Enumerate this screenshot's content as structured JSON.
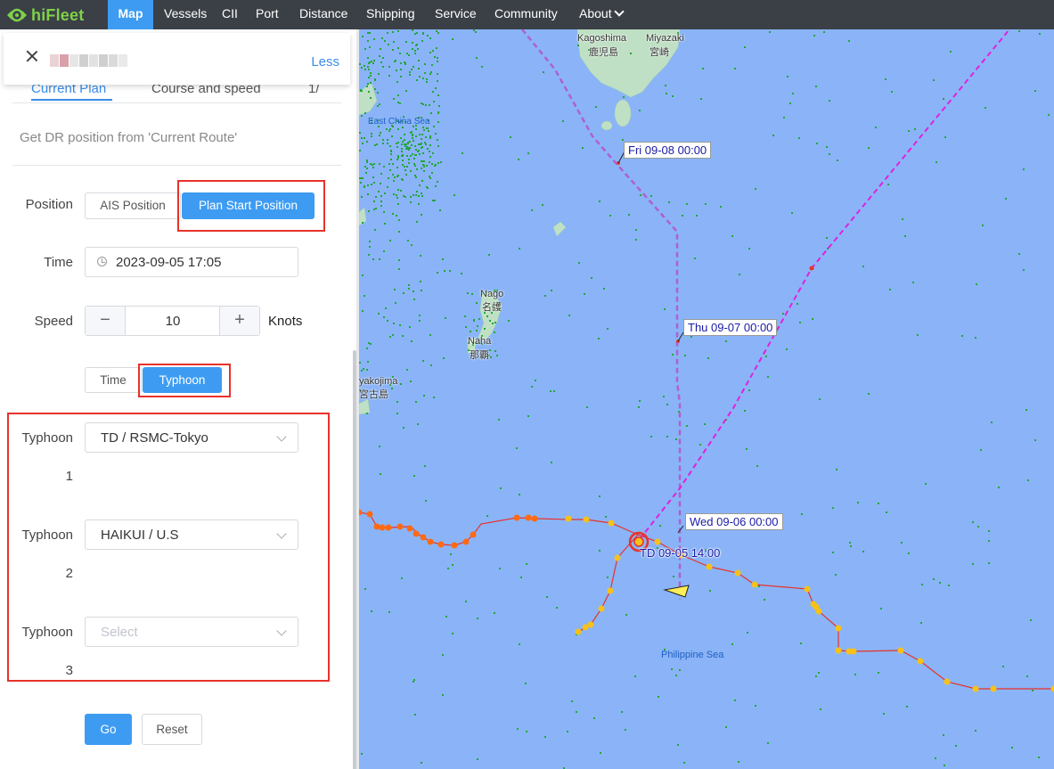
{
  "app": {
    "brand": "hiFleet"
  },
  "nav": {
    "items": [
      "Map",
      "Vessels",
      "CII",
      "Port",
      "Distance",
      "Shipping",
      "Service",
      "Community",
      "About"
    ],
    "active": "Map"
  },
  "card": {
    "less_label": "Less"
  },
  "tabs_peek": {
    "left": "Current Plan",
    "middle": "Course and speed",
    "right": "1/"
  },
  "panel": {
    "dr_text": "Get DR position from 'Current Route'",
    "position_label": "Position",
    "ais_position": "AIS Position",
    "plan_start_position": "Plan Start Position",
    "time_label": "Time",
    "time_value": "2023-09-05 17:05",
    "speed_label": "Speed",
    "speed_minus": "−",
    "speed_value": "10",
    "speed_plus": "+",
    "speed_unit": "Knots",
    "mode_time": "Time",
    "mode_typhoon": "Typhoon",
    "typhoon1_label": "Typhoon",
    "typhoon1_num": "1",
    "typhoon1_value": "TD / RSMC-Tokyo",
    "typhoon2_label": "Typhoon",
    "typhoon2_num": "2",
    "typhoon2_value": "HAIKUI / U.S",
    "typhoon3_label": "Typhoon",
    "typhoon3_num": "3",
    "typhoon3_placeholder": "Select",
    "go": "Go",
    "reset": "Reset"
  },
  "map": {
    "places": {
      "kagoshima": "Kagoshima",
      "kagoshima_jp": "鹿児島",
      "miyazaki": "Miyazaki",
      "miyazaki_jp": "宮崎",
      "east_china_sea": "East China Sea",
      "nago": "Nago",
      "nago_jp": "名護",
      "naha": "Naha",
      "naha_jp": "那覇",
      "miyakojima": "yakojima",
      "miyakojima_jp": "宮古島",
      "philippine_sea": "Philippine Sea"
    },
    "tags": {
      "fri": "Fri 09-08 00:00",
      "thu": "Thu 09-07 00:00",
      "wed": "Wed 09-06 00:00",
      "td": "TD 09-05 14:00"
    },
    "colors": {
      "sea": "#8ab4f7",
      "route": "#b05fd0",
      "forecast": "#e020e0",
      "track_orange": "#ff6a13",
      "track_yellow": "#f7c11a",
      "highlight": "#e8322a",
      "accent": "#3d9cf2"
    }
  }
}
